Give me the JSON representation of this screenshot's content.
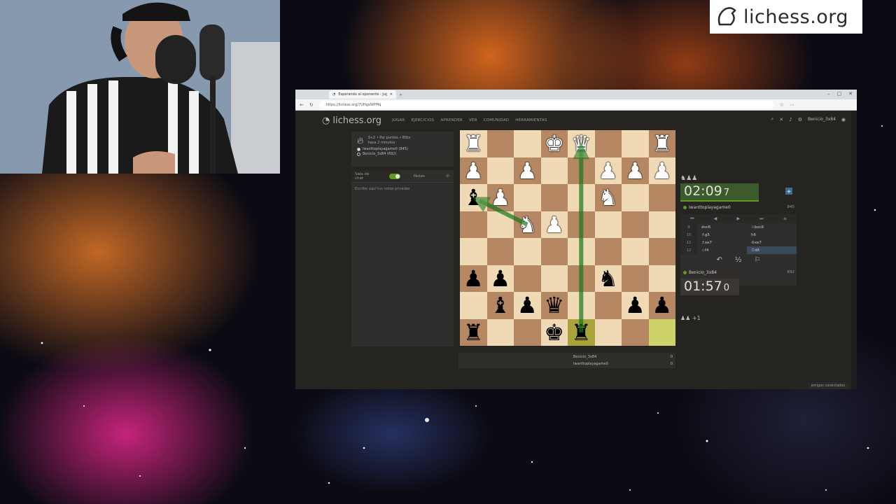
{
  "browser": {
    "tab_title": "Esperando al oponente - Jugar lic",
    "url": "https://lichess.org/7UHgxWPMq"
  },
  "logo_banner": {
    "text": "lichess.org"
  },
  "site": {
    "logo": "lichess.org",
    "nav": [
      "JUGAR",
      "EJERCICIOS",
      "APRENDER",
      "VER",
      "COMUNIDAD",
      "HERRAMIENTAS"
    ],
    "user": "Benicio_3x84"
  },
  "game_info": {
    "format": "3+2 • Por puntos • Blitz",
    "time_ago": "hace 2 minutos",
    "players": [
      "Iwanttoplayagame0 (845)",
      "Benicio_3x84 (692)"
    ]
  },
  "chat": {
    "tab_chat": "Sala de chat",
    "tab_notes": "Notas",
    "placeholder": "Escribe aquí tus notas privadas"
  },
  "board": {
    "orientation": "white-bottom-black-pieces-view",
    "squares": [
      [
        "wR",
        "",
        "",
        "wK",
        "wQ",
        "",
        "",
        "wR"
      ],
      [
        "wP",
        "",
        "wP",
        "",
        "",
        "wP",
        "wP",
        "wP"
      ],
      [
        "bB",
        "wP",
        "",
        "",
        "",
        "wN",
        "",
        ""
      ],
      [
        "",
        "",
        "wN",
        "wP",
        "",
        "",
        "",
        ""
      ],
      [
        "",
        "",
        "",
        "",
        "",
        "",
        "",
        ""
      ],
      [
        "bP",
        "bP",
        "",
        "",
        "",
        "bN",
        "",
        ""
      ],
      [
        "",
        "bB",
        "bP",
        "bQ",
        "",
        "",
        "bP",
        "bP"
      ],
      [
        "bR",
        "",
        "",
        "bK",
        "bR",
        "",
        "",
        ""
      ]
    ],
    "highlight_squares": [
      [
        7,
        4
      ],
      [
        7,
        7
      ]
    ],
    "arrows": [
      {
        "from": [
          3,
          2
        ],
        "to": [
          2,
          0
        ]
      },
      {
        "from": [
          7,
          4
        ],
        "to": [
          0,
          4
        ]
      }
    ]
  },
  "crosstable": [
    {
      "name": "Benicio_3x84",
      "score": "0"
    },
    {
      "name": "Iwanttoplayagame0",
      "score": "0"
    }
  ],
  "opponent": {
    "name": "Iwanttoplayagame0",
    "rating": "845",
    "clock_main": "02:09",
    "clock_frac": "7",
    "material": "♞♟♟"
  },
  "me": {
    "name": "Benicio_3x84",
    "rating": "692",
    "clock_main": "01:57",
    "clock_frac": "0",
    "material": "♟♟ +1"
  },
  "moves": [
    {
      "no": "9",
      "w": "dxc6",
      "b": "♘bxc6"
    },
    {
      "no": "10",
      "w": "♗g5",
      "b": "h6"
    },
    {
      "no": "11",
      "w": "♗xe7",
      "b": "♔xe7"
    },
    {
      "no": "12",
      "w": "♘f4",
      "b": "♖d8"
    }
  ],
  "friends": "amigos conectados"
}
